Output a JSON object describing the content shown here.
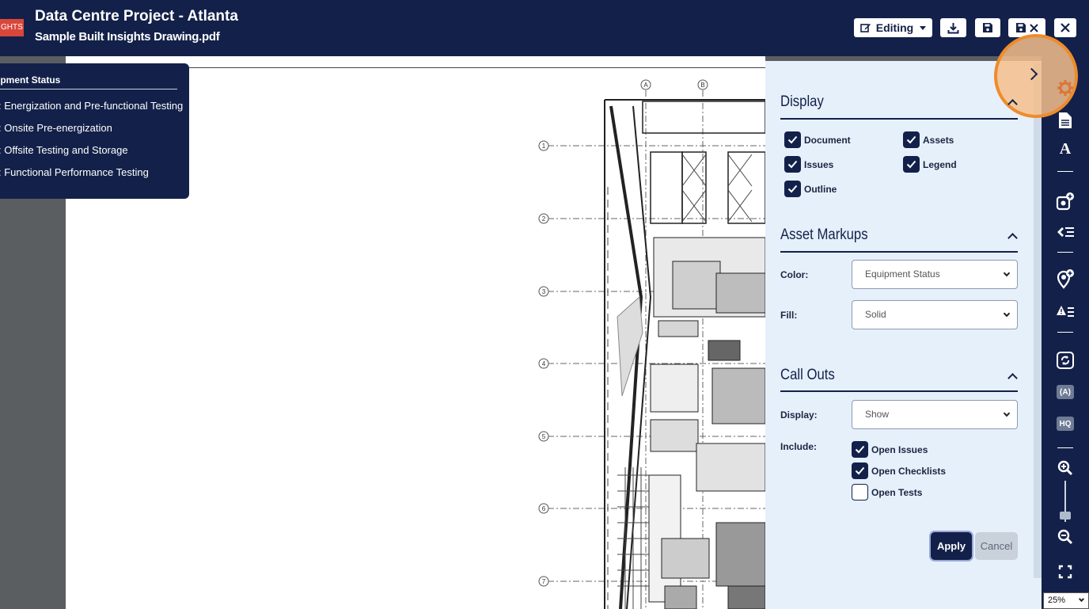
{
  "header": {
    "brand_badge": "GHTS",
    "title": "Data Centre Project - Atlanta",
    "subtitle": "Sample Built Insights Drawing.pdf",
    "mode_label": "Editing",
    "buttons": [
      "download-icon",
      "save-icon",
      "save-close-icon",
      "close-icon"
    ]
  },
  "legend": {
    "title": "ipment Status",
    "items": [
      ": Energization and Pre-functional Testing",
      ": Onsite Pre-energization",
      ": Offsite Testing and Storage",
      ": Functional Performance Testing"
    ]
  },
  "drawing": {
    "grid_columns": [
      "A",
      "B"
    ],
    "grid_rows": [
      "1",
      "2",
      "3",
      "4",
      "5",
      "6",
      "7"
    ]
  },
  "panel": {
    "display": {
      "title": "Display",
      "checkboxes": [
        {
          "label": "Document",
          "checked": true
        },
        {
          "label": "Assets",
          "checked": true
        },
        {
          "label": "Issues",
          "checked": true
        },
        {
          "label": "Legend",
          "checked": true
        },
        {
          "label": "Outline",
          "checked": true
        }
      ]
    },
    "asset_markups": {
      "title": "Asset Markups",
      "color_label": "Color:",
      "color_value": "Equipment Status",
      "fill_label": "Fill:",
      "fill_value": "Solid"
    },
    "call_outs": {
      "title": "Call Outs",
      "display_label": "Display:",
      "display_value": "Show",
      "include_label": "Include:",
      "include": [
        {
          "label": "Open Issues",
          "checked": true
        },
        {
          "label": "Open Checklists",
          "checked": true
        },
        {
          "label": "Open Tests",
          "checked": false
        }
      ]
    },
    "apply_label": "Apply",
    "cancel_label": "Cancel"
  },
  "toolbar": {
    "items": [
      "settings-icon",
      "document-icon",
      "text-icon",
      "add-asset-icon",
      "asset-list-icon",
      "add-location-icon",
      "issues-list-icon",
      "refresh-icon",
      "A-badge",
      "HQ-badge",
      "zoom-in-icon",
      "zoom-out-icon",
      "fullscreen-icon"
    ],
    "badge_a": "(A)",
    "badge_hq": "HQ",
    "zoom": "25%"
  },
  "colors": {
    "header_bg": "#13214a",
    "panel_bg": "#e6f0fb",
    "highlight": "#ef8b2c",
    "badge_red": "#d9473b"
  }
}
